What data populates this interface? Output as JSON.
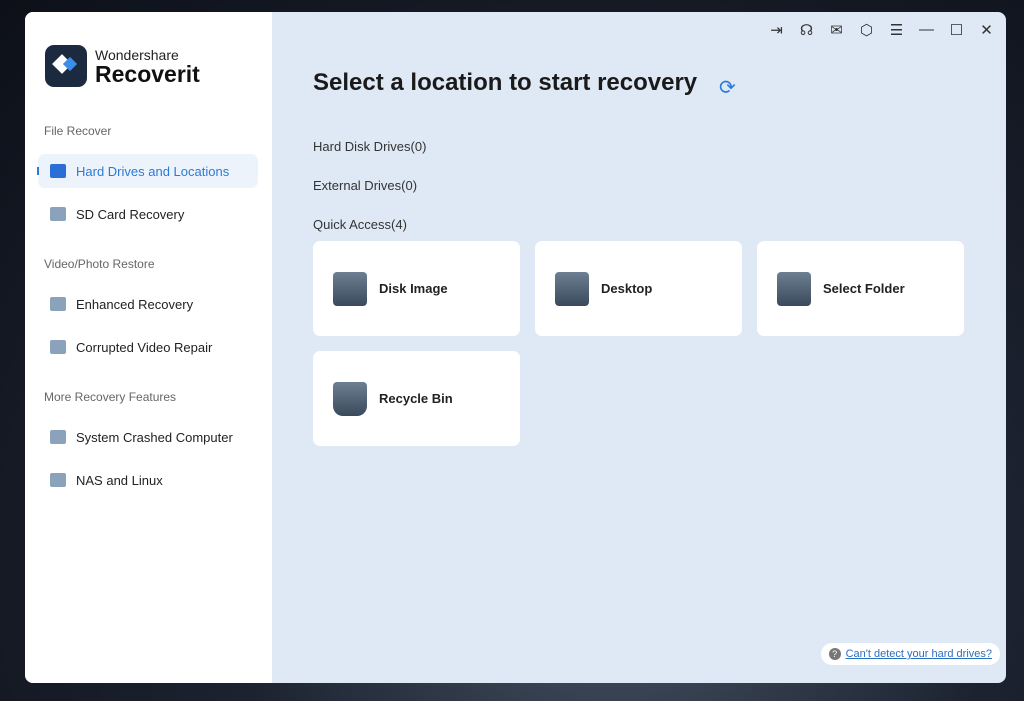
{
  "brand": {
    "line1": "Wondershare",
    "line2": "Recoverit"
  },
  "sidebar": {
    "sections": [
      "File Recover",
      "Video/Photo Restore",
      "More Recovery Features"
    ],
    "items": [
      {
        "label": "Hard Drives and Locations"
      },
      {
        "label": "SD Card Recovery"
      },
      {
        "label": "Enhanced Recovery"
      },
      {
        "label": "Corrupted Video Repair"
      },
      {
        "label": "System Crashed Computer"
      },
      {
        "label": "NAS and Linux"
      }
    ]
  },
  "toolbar": {
    "icons": [
      "sign-in-icon",
      "headset-icon",
      "mail-icon",
      "cube-icon",
      "menu-icon",
      "minimize-icon",
      "maximize-icon",
      "close-icon"
    ],
    "glyphs": [
      "⇥",
      "☊",
      "✉",
      "⬡",
      "☰",
      "—",
      "☐",
      "✕"
    ]
  },
  "main": {
    "title": "Select a location to start recovery",
    "refresh": "⟳",
    "groups": [
      "Hard Disk Drives(0)",
      "External Drives(0)",
      "Quick Access(4)"
    ],
    "cards": [
      {
        "label": "Disk Image"
      },
      {
        "label": "Desktop"
      },
      {
        "label": "Select Folder"
      },
      {
        "label": "Recycle Bin"
      }
    ],
    "help": {
      "icon": "?",
      "link": "Can't detect your hard drives?"
    }
  }
}
